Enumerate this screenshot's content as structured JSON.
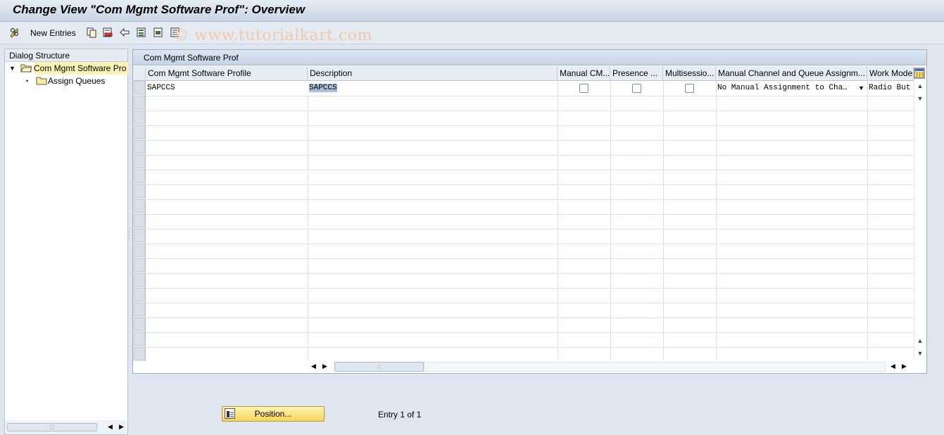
{
  "window": {
    "title": "Change View \"Com Mgmt Software Prof\": Overview"
  },
  "toolbar": {
    "new_entries_label": "New Entries",
    "icons": [
      "pencil-glasses-icon",
      "copy-icon",
      "delete-icon",
      "undo-icon",
      "select-all-icon",
      "select-block-icon",
      "deselect-all-icon"
    ]
  },
  "watermark": "© www.tutorialkart.com",
  "dialog_structure": {
    "title": "Dialog Structure",
    "items": [
      {
        "label": "Com Mgmt Software Pro",
        "selected": true,
        "level": 0
      },
      {
        "label": "Assign Queues",
        "selected": false,
        "level": 1
      }
    ]
  },
  "table": {
    "title": "Com Mgmt Software Prof",
    "columns": [
      "Com Mgmt Software Profile",
      "Description",
      "Manual CM...",
      "Presence ...",
      "Multisessio...",
      "Manual Channel and Queue Assignm...",
      "Work Mode"
    ],
    "rows": [
      {
        "profile": "SAPCCS",
        "description": "SAPCCS",
        "manual_cm": false,
        "presence": false,
        "multisession": false,
        "channel_assign": "No Manual Assignment to Cha…",
        "work_mode": "Radio But"
      }
    ]
  },
  "footer": {
    "position_label": "Position...",
    "entry_info": "Entry 1 of 1"
  }
}
